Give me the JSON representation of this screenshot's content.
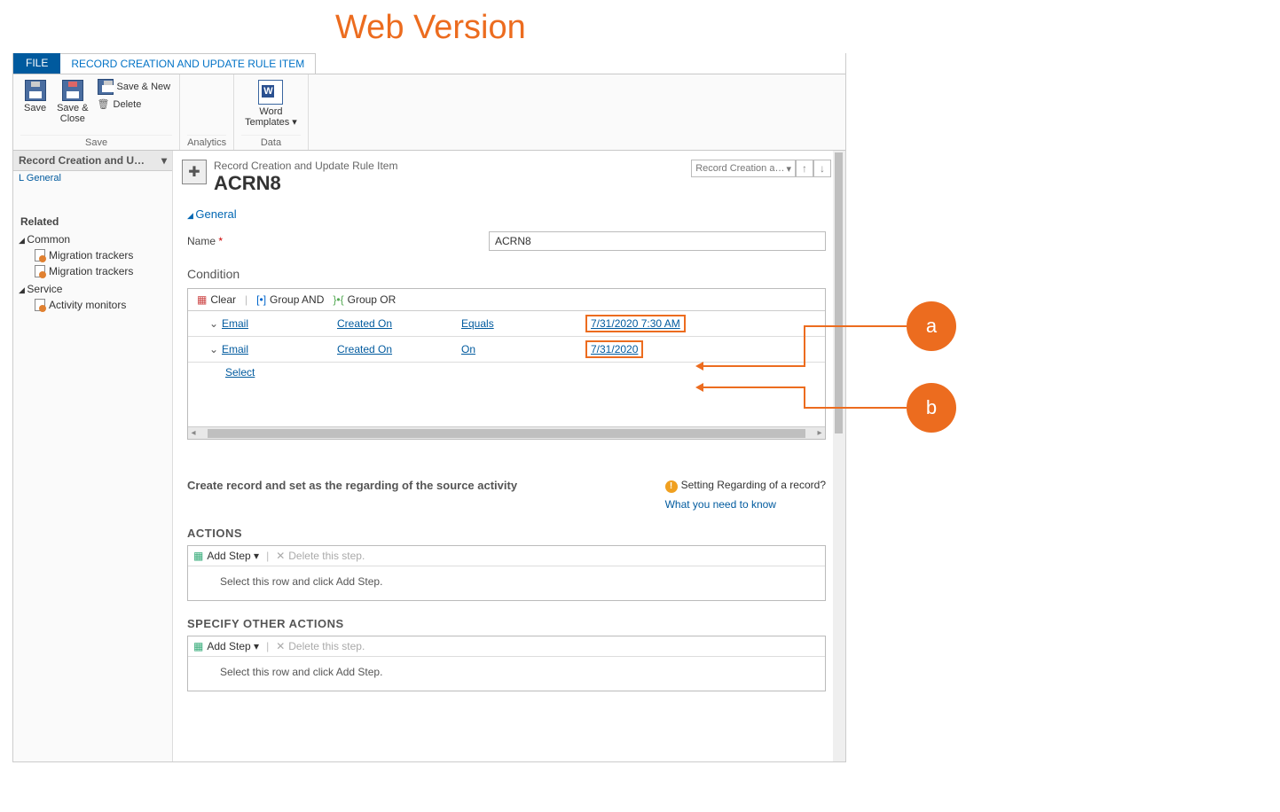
{
  "annotation_title": "Web Version",
  "tabs": {
    "file": "FILE",
    "rule": "RECORD CREATION AND UPDATE RULE ITEM"
  },
  "ribbon": {
    "save": "Save",
    "save_close": "Save &\nClose",
    "save_new": "Save & New",
    "delete": "Delete",
    "save_group": "Save",
    "analytics_group": "Analytics",
    "word_templates": "Word\nTemplates ▾",
    "data_group": "Data"
  },
  "nav": {
    "header": "Record Creation and U…",
    "general": "L General",
    "related": "Related",
    "common": "Common",
    "migr": "Migration trackers",
    "service": "Service",
    "activity": "Activity monitors"
  },
  "header": {
    "type": "Record Creation and Update Rule Item",
    "name": "ACRN8",
    "dd": "Record Creation a…"
  },
  "section_general": "General",
  "field_name_label": "Name",
  "field_name_value": "ACRN8",
  "condition_label": "Condition",
  "cond_toolbar": {
    "clear": "Clear",
    "and": "Group AND",
    "or": "Group OR"
  },
  "cond_rows": [
    {
      "entity": "Email",
      "field": "Created On",
      "op": "Equals",
      "val": "7/31/2020 7:30 AM"
    },
    {
      "entity": "Email",
      "field": "Created On",
      "op": "On",
      "val": "7/31/2020"
    }
  ],
  "cond_select": "Select",
  "below_head": "Create record and set as the regarding of the source activity",
  "info_title": "Setting Regarding of a record?",
  "info_link": "What you need to know",
  "actions_title": "ACTIONS",
  "specify_title": "SPECIFY OTHER ACTIONS",
  "add_step": "Add Step ▾",
  "delete_step": "Delete this step.",
  "step_hint": "Select this row and click Add Step.",
  "callouts": {
    "a": "a",
    "b": "b"
  }
}
